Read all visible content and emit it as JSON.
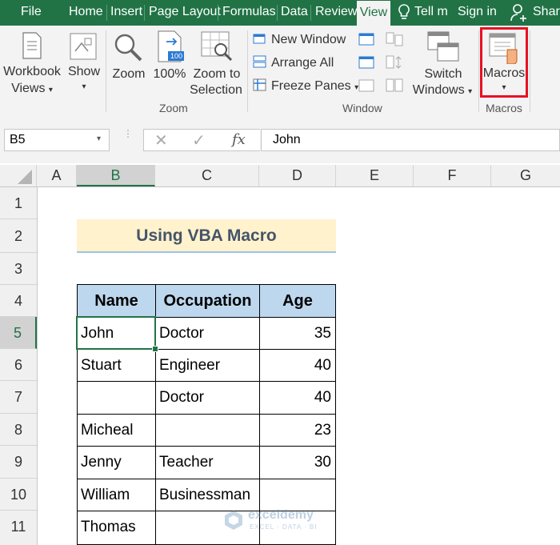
{
  "tabs": [
    "File",
    "Home",
    "Insert",
    "Page Layout",
    "Formulas",
    "Data",
    "Review",
    "View",
    "Tell m",
    "Sign in",
    "Share"
  ],
  "ribbon": {
    "workbook_views": [
      "Workbook",
      "Views"
    ],
    "show": "Show",
    "zoom": "Zoom",
    "zoom100": "100%",
    "zoom_sel": [
      "Zoom to",
      "Selection"
    ],
    "new_window": "New Window",
    "arrange_all": "Arrange All",
    "freeze_panes": "Freeze Panes",
    "switch_windows": [
      "Switch",
      "Windows"
    ],
    "macros": "Macros",
    "group_zoom": "Zoom",
    "group_window": "Window",
    "group_macros": "Macros",
    "icon_badge": "100"
  },
  "formula_bar": {
    "name_box": "B5",
    "value": "John",
    "fx": "fx"
  },
  "columns": [
    "A",
    "B",
    "C",
    "D",
    "E",
    "F",
    "G"
  ],
  "rows": [
    "1",
    "2",
    "3",
    "4",
    "5",
    "6",
    "7",
    "8",
    "9",
    "10",
    "11"
  ],
  "sheet": {
    "title": "Using VBA Macro",
    "headers": [
      "Name",
      "Occupation",
      "Age"
    ],
    "data": [
      [
        "John",
        "Doctor",
        "35"
      ],
      [
        "Stuart",
        "Engineer",
        "40"
      ],
      [
        "",
        "Doctor",
        "40"
      ],
      [
        "Micheal",
        "",
        "23"
      ],
      [
        "Jenny",
        "Teacher",
        "30"
      ],
      [
        "William",
        "Businessman",
        ""
      ],
      [
        "Thomas",
        "",
        ""
      ]
    ]
  },
  "watermark": {
    "name": "exceldemy",
    "tagline": "EXCEL · DATA · BI"
  },
  "colors": {
    "accent": "#217346",
    "header_fill": "#bdd7ee",
    "title_fill": "#fff2cc",
    "highlight": "#e81123"
  }
}
